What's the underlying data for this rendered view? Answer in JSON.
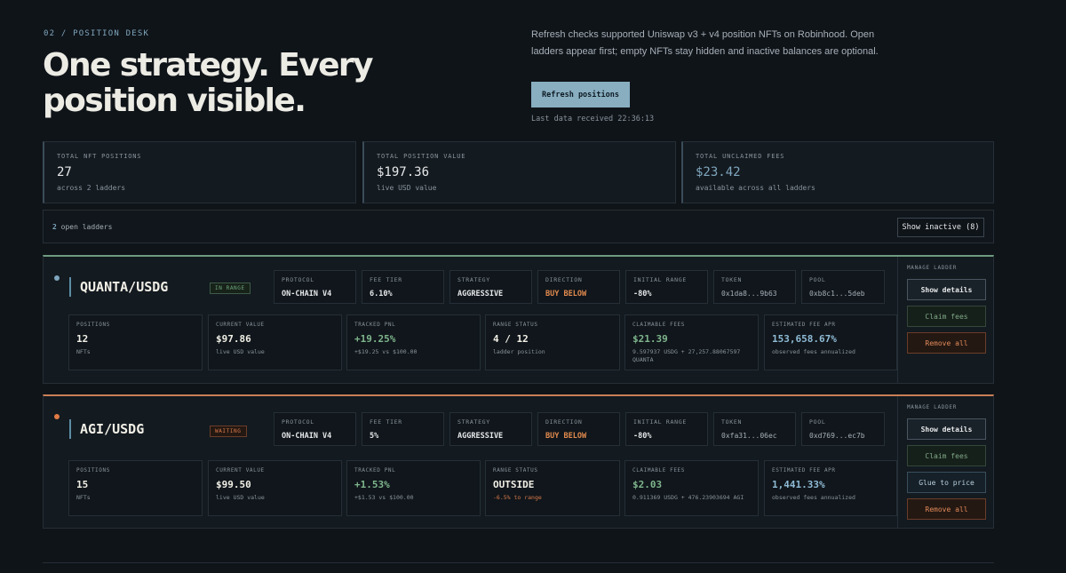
{
  "hero": {
    "eyebrow": "02 / POSITION DESK",
    "title": "One strategy. Every position visible.",
    "description": "Refresh checks supported Uniswap v3 + v4 position NFTs on Robinhood. Open ladders appear first; empty NFTs stay hidden and inactive balances are optional.",
    "refresh_label": "Refresh positions",
    "last_data": "Last data received 22:36:13"
  },
  "stats": [
    {
      "label": "TOTAL NFT POSITIONS",
      "value": "27",
      "sub": "across 2 ladders"
    },
    {
      "label": "TOTAL POSITION VALUE",
      "value": "$197.36",
      "sub": "live USD value"
    },
    {
      "label": "TOTAL UNCLAIMED FEES",
      "value": "$23.42",
      "sub": "available across all ladders"
    }
  ],
  "filter": {
    "open_count": "2",
    "open_text": "open ladders",
    "show_inactive_label": "Show inactive (8)"
  },
  "ladders": [
    {
      "pair": "QUANTA/USDG",
      "status": "IN RANGE",
      "chips": [
        {
          "label": "PROTOCOL",
          "value": "ON-CHAIN V4"
        },
        {
          "label": "FEE TIER",
          "value": "6.10%"
        },
        {
          "label": "STRATEGY",
          "value": "AGGRESSIVE"
        },
        {
          "label": "DIRECTION",
          "value": "BUY BELOW"
        },
        {
          "label": "INITIAL RANGE",
          "value": "-80%"
        },
        {
          "label": "TOKEN",
          "value": "0x1da8...9b63"
        },
        {
          "label": "POOL",
          "value": "0xb8c1...5deb"
        }
      ],
      "metrics": [
        {
          "label": "POSITIONS",
          "value": "12",
          "sub": "NFTs"
        },
        {
          "label": "CURRENT VALUE",
          "value": "$97.86",
          "sub": "live USD value"
        },
        {
          "label": "TRACKED PNL",
          "value": "+19.25%",
          "sub": "+$19.25 vs $100.00"
        },
        {
          "label": "RANGE STATUS",
          "value": "4 / 12",
          "sub": "ladder position"
        },
        {
          "label": "CLAIMABLE FEES",
          "value": "$21.39",
          "sub": "9.597937 USDG + 27,257.88067597 QUANTA"
        },
        {
          "label": "ESTIMATED FEE APR",
          "value": "153,658.67%",
          "sub": "observed fees annualized"
        }
      ],
      "manage": {
        "label": "MANAGE LADDER",
        "details": "Show details",
        "claim": "Claim fees",
        "remove": "Remove all"
      }
    },
    {
      "pair": "AGI/USDG",
      "status": "WAITING",
      "chips": [
        {
          "label": "PROTOCOL",
          "value": "ON-CHAIN V4"
        },
        {
          "label": "FEE TIER",
          "value": "5%"
        },
        {
          "label": "STRATEGY",
          "value": "AGGRESSIVE"
        },
        {
          "label": "DIRECTION",
          "value": "BUY BELOW"
        },
        {
          "label": "INITIAL RANGE",
          "value": "-80%"
        },
        {
          "label": "TOKEN",
          "value": "0xfa31...06ec"
        },
        {
          "label": "POOL",
          "value": "0xd769...ec7b"
        }
      ],
      "metrics": [
        {
          "label": "POSITIONS",
          "value": "15",
          "sub": "NFTs"
        },
        {
          "label": "CURRENT VALUE",
          "value": "$99.50",
          "sub": "live USD value"
        },
        {
          "label": "TRACKED PNL",
          "value": "+1.53%",
          "sub": "+$1.53 vs $100.00"
        },
        {
          "label": "RANGE STATUS",
          "value": "OUTSIDE",
          "sub": "-6.5% to range"
        },
        {
          "label": "CLAIMABLE FEES",
          "value": "$2.03",
          "sub": "0.911369 USDG + 476.23903694 AGI"
        },
        {
          "label": "ESTIMATED FEE APR",
          "value": "1,441.33%",
          "sub": "observed fees annualized"
        }
      ],
      "manage": {
        "label": "MANAGE LADDER",
        "details": "Show details",
        "claim": "Claim fees",
        "glue": "Glue to price",
        "remove": "Remove all"
      }
    }
  ],
  "colors": {
    "accent_blue": "#88aec0",
    "in_range_green": "#6fa77f",
    "waiting_orange": "#d9784a",
    "background": "#0f1419"
  }
}
